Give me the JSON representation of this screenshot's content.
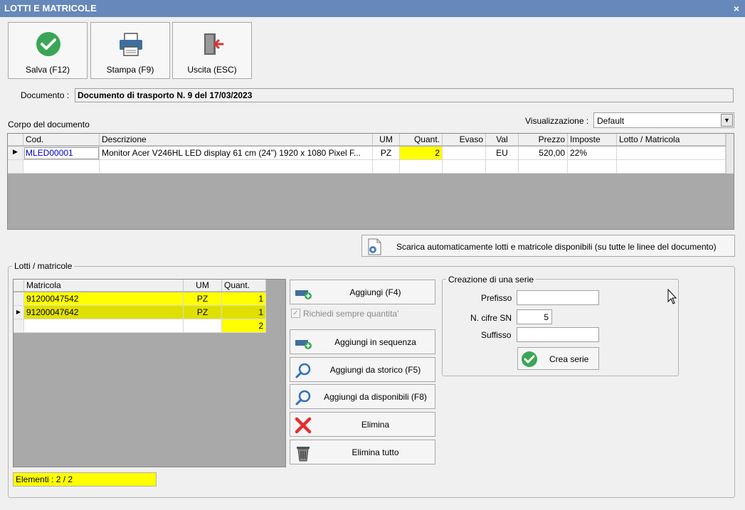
{
  "window": {
    "title": "LOTTI E MATRICOLE",
    "close_glyph": "×"
  },
  "toolbar": {
    "save_label": "Salva (F12)",
    "print_label": "Stampa (F9)",
    "exit_label": "Uscita (ESC)"
  },
  "documento": {
    "label": "Documento :",
    "value": "Documento di trasporto N. 9 del 17/03/2023"
  },
  "corpo": {
    "label": "Corpo del documento",
    "view_label": "Visualizzazione :",
    "view_value": "Default",
    "columns": [
      "Cod.",
      "Descrizione",
      "UM",
      "Quant.",
      "Evaso",
      "Val",
      "Prezzo",
      "Imposte",
      "Lotto / Matricola"
    ],
    "rows": [
      {
        "cod": "MLED00001",
        "descrizione": "Monitor Acer V246HL LED display 61 cm (24\") 1920 x 1080 Pixel F...",
        "um": "PZ",
        "quant": "2",
        "evaso": "",
        "val": "EU",
        "prezzo": "520,00",
        "imposte": "22%",
        "lotto": ""
      }
    ],
    "auto_button": "Scarica automaticamente lotti e matricole disponibili (su tutte le linee del documento)"
  },
  "lotti": {
    "label": "Lotti / matricole",
    "columns": [
      "Matricola",
      "UM",
      "Quant."
    ],
    "rows": [
      {
        "matricola": "91200047542",
        "um": "PZ",
        "quant": "1"
      },
      {
        "matricola": "91200047642",
        "um": "PZ",
        "quant": "1"
      }
    ],
    "total": "2",
    "elementi": "Elementi : 2 / 2",
    "checkbox_label": "Richiedi sempre quantita'",
    "checkbox_checked": true,
    "buttons": {
      "aggiungi": "Aggiungi (F4)",
      "sequenza": "Aggiungi in sequenza",
      "storico": "Aggiungi da storico (F5)",
      "disponibili": "Aggiungi da disponibili (F8)",
      "elimina": "Elimina",
      "elimina_tutto": "Elimina tutto"
    }
  },
  "serie": {
    "title": "Creazione di una serie",
    "prefisso_label": "Prefisso",
    "prefisso_value": "",
    "cifre_label": "N. cifre SN",
    "cifre_value": "5",
    "suffisso_label": "Suffisso",
    "suffisso_value": "",
    "crea_label": "Crea serie"
  },
  "colors": {
    "title_bar": "#6688bb",
    "highlight": "#ffff00",
    "row_selected": "#e0e000",
    "grid_bg": "#a9a9a9",
    "link": "#0000cc"
  }
}
